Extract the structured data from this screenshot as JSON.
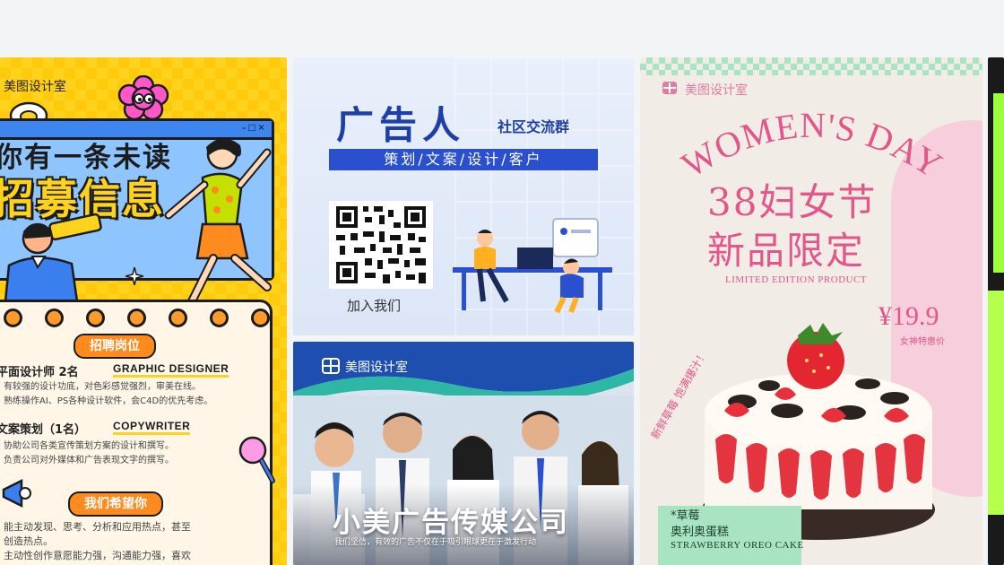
{
  "cards": [
    {
      "id": "recruitment",
      "brand": "美图设计室",
      "headline_1": "你有一条未读",
      "headline_2": "招募信息",
      "window_controls": "- □ ×",
      "section_1": "招聘岗位",
      "role_1_cn": "平面设计师 2名",
      "role_1_en": "GRAPHIC DESIGNER",
      "role_1_desc_1": "有较强的设计功底，对色彩感觉强烈，审美在线。",
      "role_1_desc_2": "熟练操作AI、PS各种设计软件，会C4D的优先考虑。",
      "role_2_cn": "文案策划（1名）",
      "role_2_en": "COPYWRITER",
      "role_2_desc_1": "协助公司各类宣传策划方案的设计和撰写。",
      "role_2_desc_2": "负责公司对外媒体和广告表现文字的撰写。",
      "section_2": "我们希望你",
      "hope_1": "能主动发现、思考、分析和应用热点，甚至",
      "hope_2": "创造热点。",
      "hope_3": "主动性创作意愿能力强，沟通能力强，喜欢"
    },
    {
      "id": "ad-community",
      "title": "广告人",
      "subtitle": "社区交流群",
      "tags": "策划/文案/设计/客户",
      "cta": "加入我们"
    },
    {
      "id": "media-company",
      "brand": "美图设计室",
      "company": "小美广告传媒公司",
      "slogan": "我们坚信，有效的广告不仅在于吸引眼球更在于激发行动"
    },
    {
      "id": "womens-day",
      "brand": "美图设计室",
      "arc_title": "WOMEN'S DAY",
      "cn_title_1": "38妇女节",
      "cn_title_2": "新品限定",
      "limited": "LIMITED EDITION PRODUCT",
      "price": "¥19.9",
      "price_tag": "女神特惠价",
      "side_text": "新鲜草莓 饱满爆汁！",
      "product_1": "*草莓",
      "product_2": "奥利奥蛋糕",
      "product_en": "STRAWBERRY OREO CAKE"
    }
  ],
  "colors": {
    "yellow": "#ffd21c",
    "blue_brand": "#1f3fa8",
    "pink": "#e3568b",
    "mint": "#a8e3c2"
  }
}
